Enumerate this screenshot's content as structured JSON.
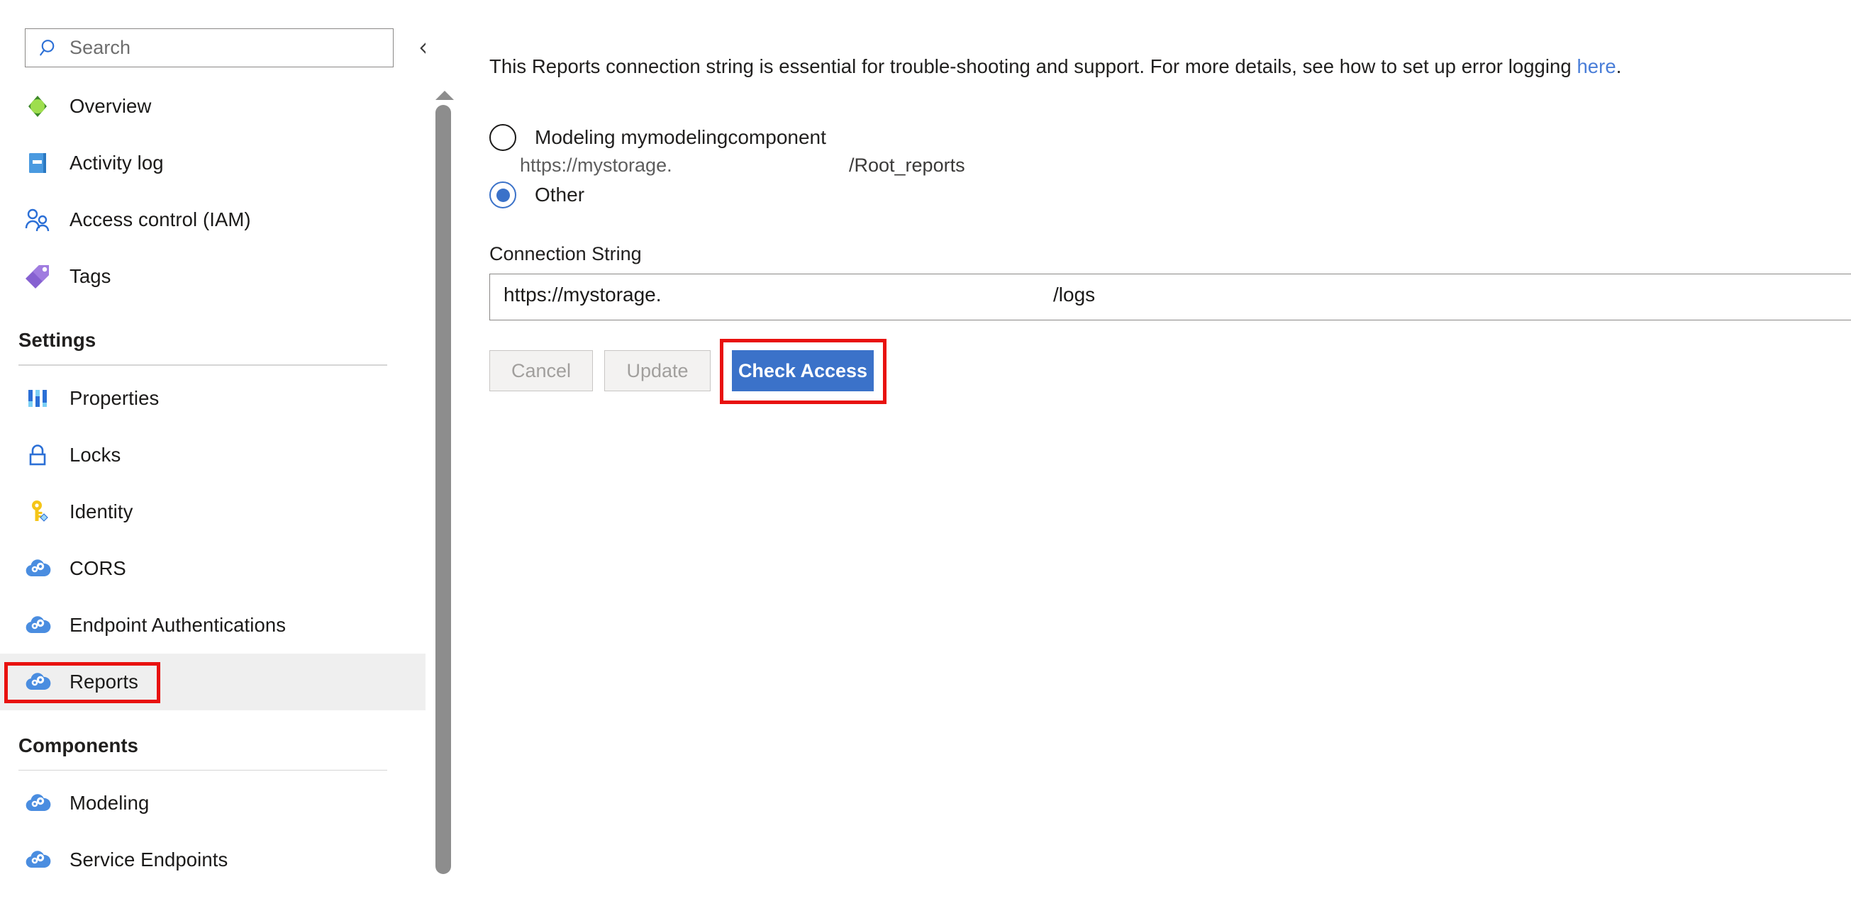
{
  "sidebar": {
    "search": {
      "placeholder": "Search",
      "icon": "search-icon"
    },
    "collapse_icon": "chevron-double-left-icon",
    "items": [
      {
        "label": "Overview",
        "icon": "overview-icon",
        "selected": false,
        "group": null
      },
      {
        "label": "Activity log",
        "icon": "activity-log-icon",
        "selected": false,
        "group": null
      },
      {
        "label": "Access control (IAM)",
        "icon": "access-control-icon",
        "selected": false,
        "group": null
      },
      {
        "label": "Tags",
        "icon": "tags-icon",
        "selected": false,
        "group": null
      },
      {
        "label": "Properties",
        "icon": "properties-icon",
        "selected": false,
        "group": "Settings"
      },
      {
        "label": "Locks",
        "icon": "locks-icon",
        "selected": false,
        "group": "Settings"
      },
      {
        "label": "Identity",
        "icon": "identity-icon",
        "selected": false,
        "group": "Settings"
      },
      {
        "label": "CORS",
        "icon": "cloud-gears-icon",
        "selected": false,
        "group": "Settings"
      },
      {
        "label": "Endpoint Authentications",
        "icon": "cloud-gears-icon",
        "selected": false,
        "group": "Settings"
      },
      {
        "label": "Reports",
        "icon": "cloud-gears-icon",
        "selected": true,
        "group": "Settings"
      },
      {
        "label": "Modeling",
        "icon": "cloud-gears-icon",
        "selected": false,
        "group": "Components"
      },
      {
        "label": "Service Endpoints",
        "icon": "cloud-gears-icon",
        "selected": false,
        "group": "Components"
      }
    ],
    "groups": {
      "settings_title": "Settings",
      "components_title": "Components"
    }
  },
  "main": {
    "intro": {
      "text_before": "This Reports connection string is essential for trouble-shooting and support. For more details, see how to set up error logging ",
      "link_text": "here",
      "text_after": "."
    },
    "radios": [
      {
        "label": "Modeling mymodelingcomponent",
        "selected": false,
        "sub_left": "https://mystorage.",
        "sub_right": "/Root_reports"
      },
      {
        "label": "Other",
        "selected": true,
        "sub_left": "",
        "sub_right": ""
      }
    ],
    "connection_string": {
      "label": "Connection String",
      "value_left": "https://mystorage.",
      "value_right": "/logs"
    },
    "buttons": {
      "cancel": "Cancel",
      "update": "Update",
      "check_access": "Check Access"
    }
  },
  "colors": {
    "accent_blue": "#3b72c9",
    "link_blue": "#4a7ed8",
    "highlight_red": "#e8110f",
    "selected_row_bg": "#efefef"
  }
}
